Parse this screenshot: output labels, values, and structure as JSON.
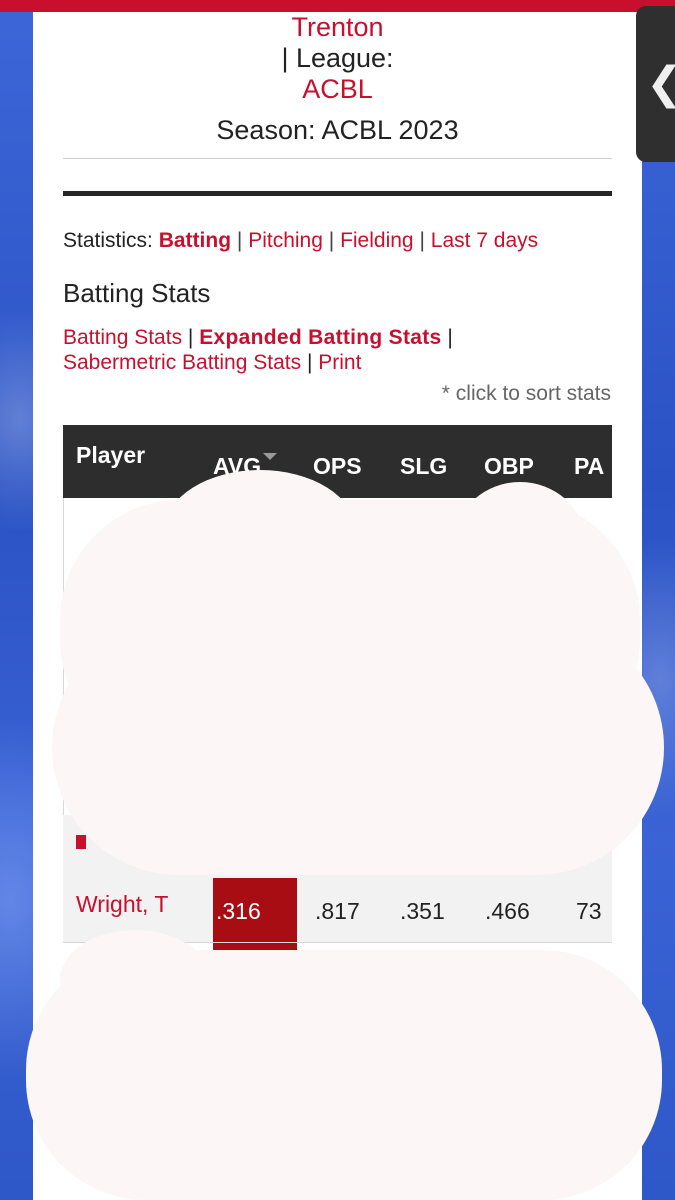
{
  "header": {
    "team": "Trenton",
    "league_label": "|  League:",
    "league_name": "ACBL",
    "season": "Season: ACBL 2023"
  },
  "nav": {
    "statistics_label": "Statistics:",
    "batting": "Batting",
    "pitching": "Pitching",
    "fielding": "Fielding",
    "last7": "Last 7 days",
    "separator": "|"
  },
  "section": {
    "title": "Batting Stats",
    "links": {
      "batting_stats": "Batting Stats",
      "expanded": "Expanded Batting Stats",
      "sabermetric": "Sabermetric Batting Stats",
      "print": "Print"
    },
    "sort_note": "* click to sort stats"
  },
  "table": {
    "columns": [
      "Player",
      "AVG",
      "OPS",
      "SLG",
      "OBP",
      "PA"
    ],
    "rows": [
      {
        "player": "Wright, T",
        "avg": ".316",
        "ops": ".817",
        "slg": ".351",
        "obp": ".466",
        "pa": "73"
      }
    ]
  },
  "side_tab": {
    "icon": "chevron-left-icon",
    "glyph": "❮"
  },
  "colors": {
    "accent": "#c8102e",
    "header_bg": "#2d2d2d",
    "sorted_cell": "#a70d13",
    "background": "#2b56c9"
  }
}
